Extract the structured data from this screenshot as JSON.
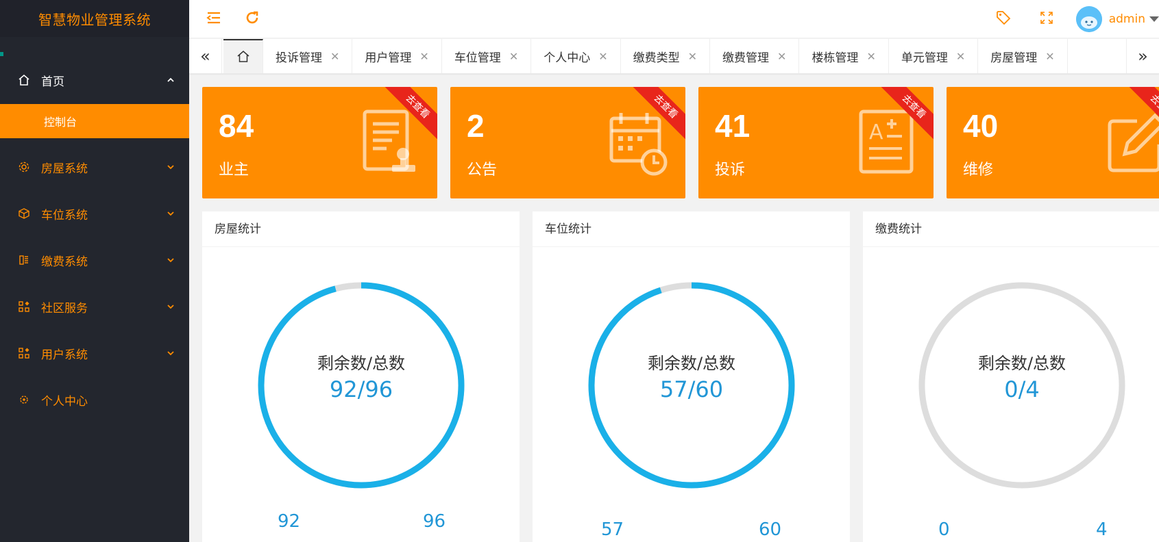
{
  "app": {
    "title": "智慧物业管理系统"
  },
  "colors": {
    "accent": "#ff8c00",
    "sidebar": "#23262e",
    "ribbon": "#e8251b",
    "ring": "#1ab0e8",
    "ringTrack": "#dddddd",
    "value": "#2196d6"
  },
  "sidebar": {
    "items": [
      {
        "label": "首页",
        "icon": "home-icon"
      },
      {
        "label": "控制台"
      },
      {
        "label": "房屋系统",
        "icon": "gear-icon"
      },
      {
        "label": "车位系统",
        "icon": "cube-icon"
      },
      {
        "label": "缴费系统",
        "icon": "bill-icon"
      },
      {
        "label": "社区服务",
        "icon": "apps-icon"
      },
      {
        "label": "用户系统",
        "icon": "apps-icon"
      },
      {
        "label": "个人中心",
        "icon": "star-icon"
      }
    ]
  },
  "header": {
    "user": "admin"
  },
  "tabs": [
    "投诉管理",
    "用户管理",
    "车位管理",
    "个人中心",
    "缴费类型",
    "缴费管理",
    "楼栋管理",
    "单元管理",
    "房屋管理"
  ],
  "cards": [
    {
      "value": "84",
      "label": "业主",
      "ribbon": "去查看",
      "icon": "document-stamp-icon"
    },
    {
      "value": "2",
      "label": "公告",
      "ribbon": "去查看",
      "icon": "calendar-clock-icon"
    },
    {
      "value": "41",
      "label": "投诉",
      "ribbon": "去查看",
      "icon": "text-doc-icon"
    },
    {
      "value": "40",
      "label": "维修",
      "ribbon": "去查看",
      "icon": "edit-icon"
    }
  ],
  "panels": [
    {
      "title": "房屋统计",
      "ring_label": "剩余数/总数",
      "ring_value": "92/96",
      "remaining": 92,
      "total": 96,
      "left_num": "92",
      "right_num": "96"
    },
    {
      "title": "车位统计",
      "ring_label": "剩余数/总数",
      "ring_value": "57/60",
      "remaining": 57,
      "total": 60,
      "left_num": "57",
      "right_num": "60"
    },
    {
      "title": "缴费统计",
      "ring_label": "剩余数/总数",
      "ring_value": "0/4",
      "remaining": 0,
      "total": 4,
      "left_num": "0",
      "right_num": "4"
    }
  ]
}
